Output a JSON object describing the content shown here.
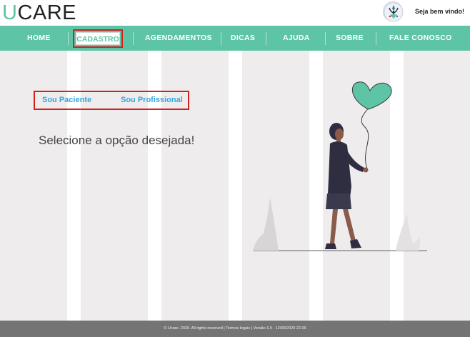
{
  "header": {
    "logo_first": "U",
    "logo_rest": "CARE",
    "welcome": "Seja bem vindo!"
  },
  "nav": {
    "items": [
      {
        "label": "HOME"
      },
      {
        "label": "CADASTRO",
        "active": true
      },
      {
        "label": "AGENDAMENTOS"
      },
      {
        "label": "DICAS"
      },
      {
        "label": "AJUDA"
      },
      {
        "label": "SOBRE"
      },
      {
        "label": "FALE CONOSCO"
      }
    ]
  },
  "main": {
    "options": [
      "Sou Paciente",
      "Sou Profissional"
    ],
    "prompt": "Selecione a opção desejada!"
  },
  "footer": {
    "text": "© Ucare. 2020. All rights reserved | Termos legais | Versão 1.0 - 12/09/2020 22:26"
  },
  "colors": {
    "brand": "#5dc4a6",
    "link": "#2fa8e0",
    "highlight": "#d32020",
    "footer_bg": "#747474",
    "page_bg": "#efecee"
  },
  "icons": {
    "user": "user-avatar-icon",
    "illustration": "woman-with-heart-balloon-illustration"
  }
}
